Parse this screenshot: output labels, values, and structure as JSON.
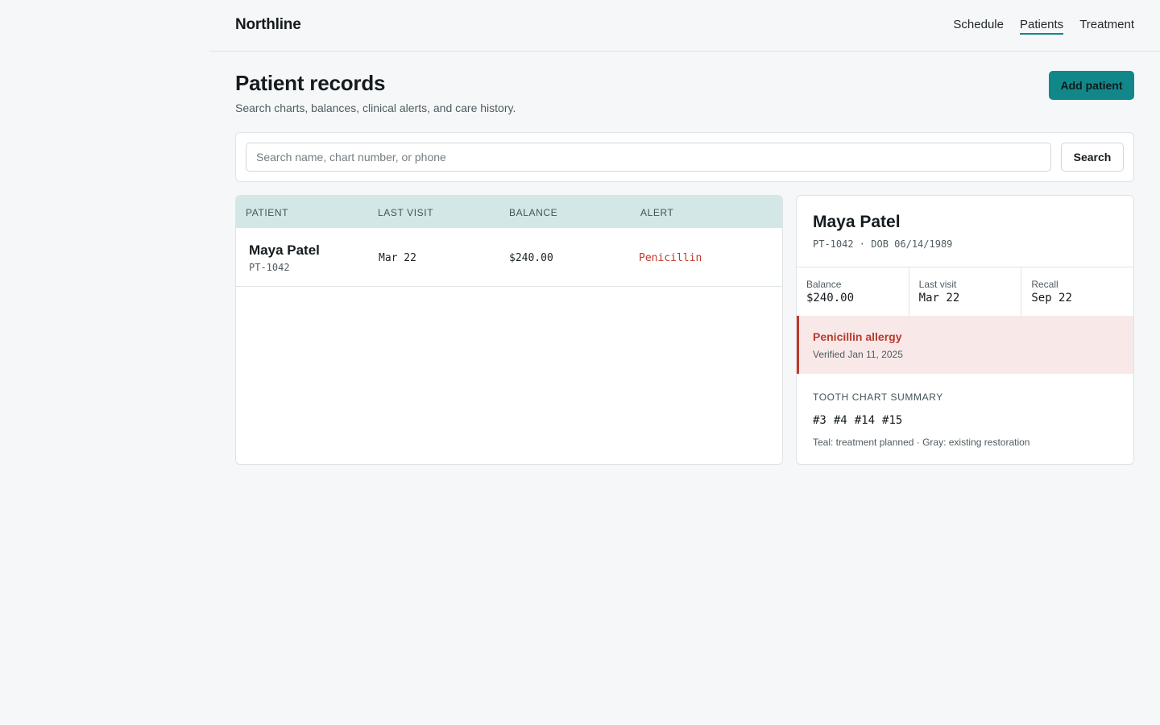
{
  "app": {
    "brand": "Northline"
  },
  "nav": {
    "items": [
      {
        "label": "Schedule",
        "active": false
      },
      {
        "label": "Patients",
        "active": true
      },
      {
        "label": "Treatment",
        "active": false
      }
    ]
  },
  "header": {
    "title": "Patient records",
    "subtitle": "Search charts, balances, clinical alerts, and care history.",
    "add_button": "Add patient"
  },
  "search": {
    "placeholder": "Search name, chart number, or phone",
    "value": "",
    "button": "Search"
  },
  "table": {
    "columns": [
      "PATIENT",
      "LAST VISIT",
      "BALANCE",
      "ALERT"
    ],
    "rows": [
      {
        "name": "Maya Patel",
        "id": "PT-1042",
        "last_visit": "Mar 22",
        "balance": "$240.00",
        "alert": "Penicillin"
      }
    ]
  },
  "detail": {
    "name": "Maya Patel",
    "meta": "PT-1042 · DOB 06/14/1989",
    "stats": [
      {
        "label": "Balance",
        "value": "$240.00"
      },
      {
        "label": "Last visit",
        "value": "Mar 22"
      },
      {
        "label": "Recall",
        "value": "Sep 22"
      }
    ],
    "alert": {
      "title": "Penicillin allergy",
      "subtitle": "Verified Jan 11, 2025"
    },
    "tooth_chart": {
      "title": "TOOTH CHART SUMMARY",
      "teeth": [
        "#3",
        "#4",
        "#14",
        "#15"
      ],
      "legend": "Teal: treatment planned · Gray: existing restoration"
    }
  },
  "colors": {
    "accent": "#12878a",
    "table_header_bg": "#d4e7e7",
    "alert_red": "#c0392b",
    "alert_bg": "#f8e9e8",
    "page_bg": "#f5f7f8"
  }
}
